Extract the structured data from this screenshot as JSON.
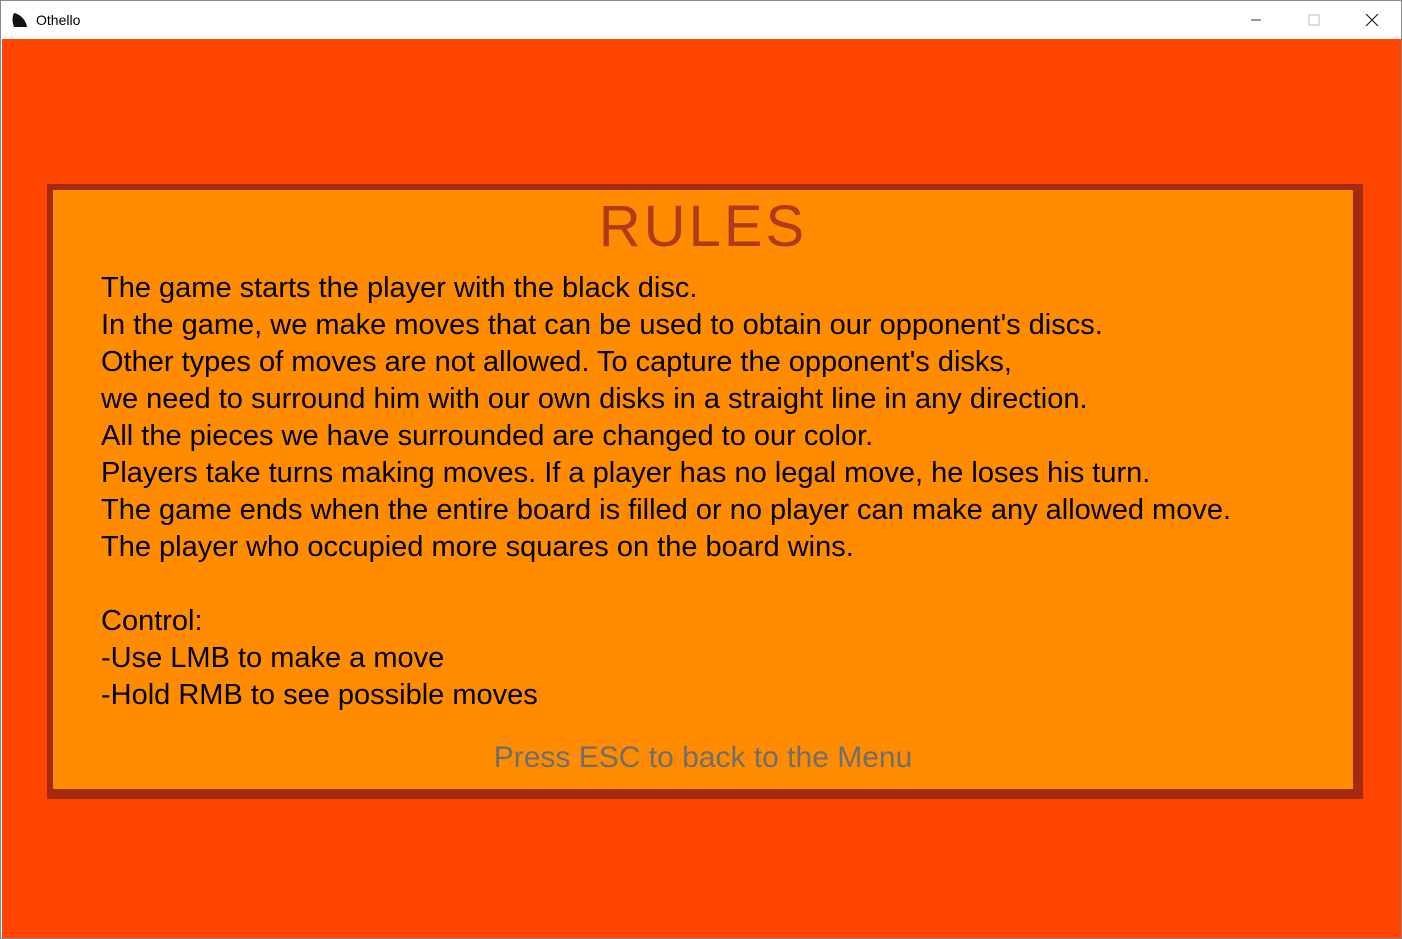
{
  "window": {
    "title": "Othello",
    "icon": "othello-app-icon",
    "controls": [
      "minimize-icon",
      "maximize-icon",
      "close-icon"
    ]
  },
  "colors": {
    "background": "#ff4500",
    "panel": "#ff8c00",
    "panel_border": "#a52a12",
    "title": "#b03a1c",
    "body_text": "#000000",
    "hint_text": "#6e6e6e"
  },
  "rules_screen": {
    "heading": "RULES",
    "lines": [
      "The game starts the player with the black disc.",
      "In the game, we make moves that can be used to obtain our opponent's discs.",
      "Other types of moves are not allowed. To capture the opponent's disks,",
      "we need to surround him with our own disks in a straight line in any direction.",
      "All the pieces we have surrounded are changed to our color.",
      "Players take turns making moves. If a player has no legal move, he loses his turn.",
      "The game ends when the entire board is filled or no player can make any allowed move.",
      "The player who occupied more squares on the board wins."
    ],
    "control_heading": "Control:",
    "controls": [
      "-Use LMB to make a move",
      "-Hold RMB to see possible moves"
    ],
    "back_hint": "Press ESC to back to the Menu"
  }
}
